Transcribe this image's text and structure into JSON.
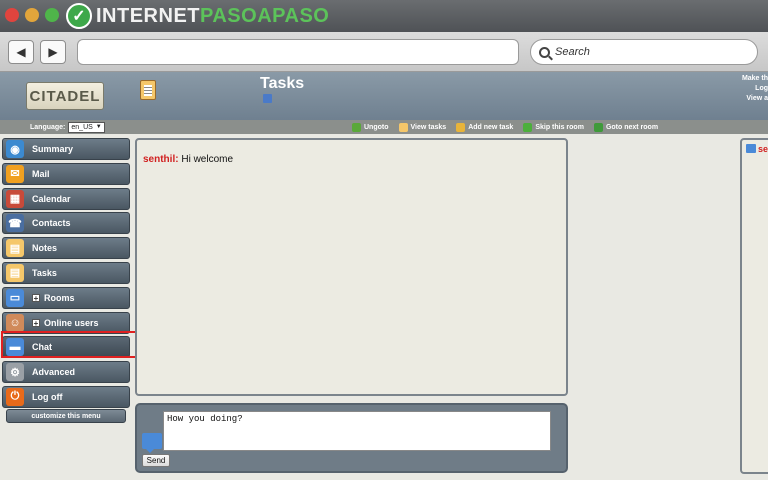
{
  "brand": {
    "text_white": "INTERNET",
    "text_green": "PASOAPASO"
  },
  "browser": {
    "search_placeholder": "Search",
    "url_value": ""
  },
  "header": {
    "logo": "CITADEL",
    "title": "Tasks",
    "right_lines": [
      "Make th",
      "Log",
      "View a"
    ]
  },
  "subbar": {
    "language_label": "Language:",
    "language_value": "en_US",
    "actions": [
      "Ungoto",
      "View tasks",
      "Add new task",
      "Skip this room",
      "Goto next room"
    ]
  },
  "sidebar": {
    "items": [
      "Summary",
      "Mail",
      "Calendar",
      "Contacts",
      "Notes",
      "Tasks",
      "Rooms",
      "Online users",
      "Chat",
      "Advanced",
      "Log off"
    ],
    "customize_label": "customize this menu"
  },
  "chat": {
    "messages": [
      {
        "user": "senthil:",
        "text": "Hi welcome"
      }
    ],
    "input_value": "How you doing?",
    "send_label": "Send"
  },
  "right_panel": {
    "label": "sen"
  },
  "colors": {
    "chat_user": "#d12020",
    "highlight": "#e02020",
    "brand_green": "#5cc35a"
  }
}
